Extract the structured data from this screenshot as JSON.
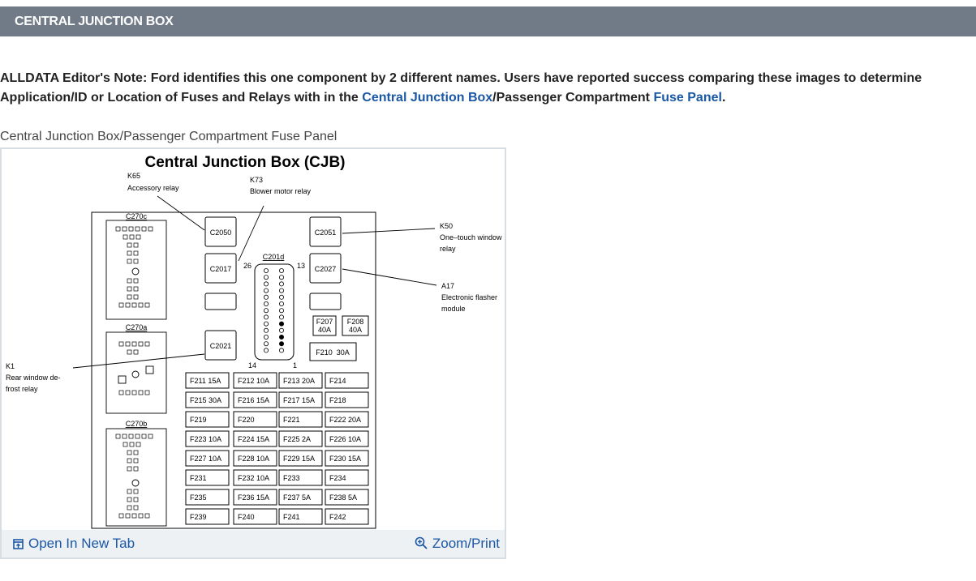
{
  "header": {
    "title": "CENTRAL JUNCTION BOX"
  },
  "note": {
    "prefix": "ALLDATA Editor's Note: Ford identifies this one component by 2 different names. Users have reported success comparing these images to determine Application/ID or Location of Fuses and Relays with in the ",
    "link1": "Central Junction Box",
    "middle": "/Passenger Compartment ",
    "link2": "Fuse Panel",
    "suffix": "."
  },
  "caption": "Central Junction Box/Passenger Compartment Fuse Panel",
  "diagram": {
    "title": "Central Junction Box (CJB)",
    "callouts": {
      "k65_id": "K65",
      "k65_name": "Accessory relay",
      "k73_id": "K73",
      "k73_name": "Blower motor relay",
      "k50_id": "K50",
      "k50_name1": "One–touch window",
      "k50_name2": "relay",
      "a17_id": "A17",
      "a17_name1": "Electronic flasher",
      "a17_name2": "module",
      "k1_id": "K1",
      "k1_name1": "Rear window de-",
      "k1_name2": "frost relay"
    },
    "connectors": {
      "c270c": "C270c",
      "c270a": "C270a",
      "c270b": "C270b",
      "c201d": "C201d"
    },
    "relays": {
      "c2050": "C2050",
      "c2051": "C2051",
      "c2017": "C2017",
      "c2027": "C2027",
      "c2021": "C2021"
    },
    "pins": {
      "p26": "26",
      "p13": "13",
      "p14": "14",
      "p1": "1"
    },
    "big_fuses": {
      "f207": "F207",
      "f207a": "40A",
      "f208": "F208",
      "f208a": "40A",
      "f210": "F210  30A"
    },
    "fuses": [
      "F211  15A",
      "F212  10A",
      "F213  20A",
      "F214",
      "F215  30A",
      "F216  15A",
      "F217  15A",
      "F218",
      "F219",
      "F220",
      "F221",
      "F222  20A",
      "F223  10A",
      "F224  15A",
      "F225  2A",
      "F226  10A",
      "F227  10A",
      "F228  10A",
      "F229  15A",
      "F230  15A",
      "F231",
      "F232  10A",
      "F233",
      "F234",
      "F235",
      "F236  15A",
      "F237  5A",
      "F238  5A",
      "F239",
      "F240",
      "F241",
      "F242"
    ]
  },
  "actions": {
    "open_new_tab": "Open In New Tab",
    "zoom_print": "Zoom/Print"
  },
  "colors": {
    "header_bg": "#717b87",
    "link": "#1a57a4",
    "footer_bg": "#eef1f4"
  }
}
